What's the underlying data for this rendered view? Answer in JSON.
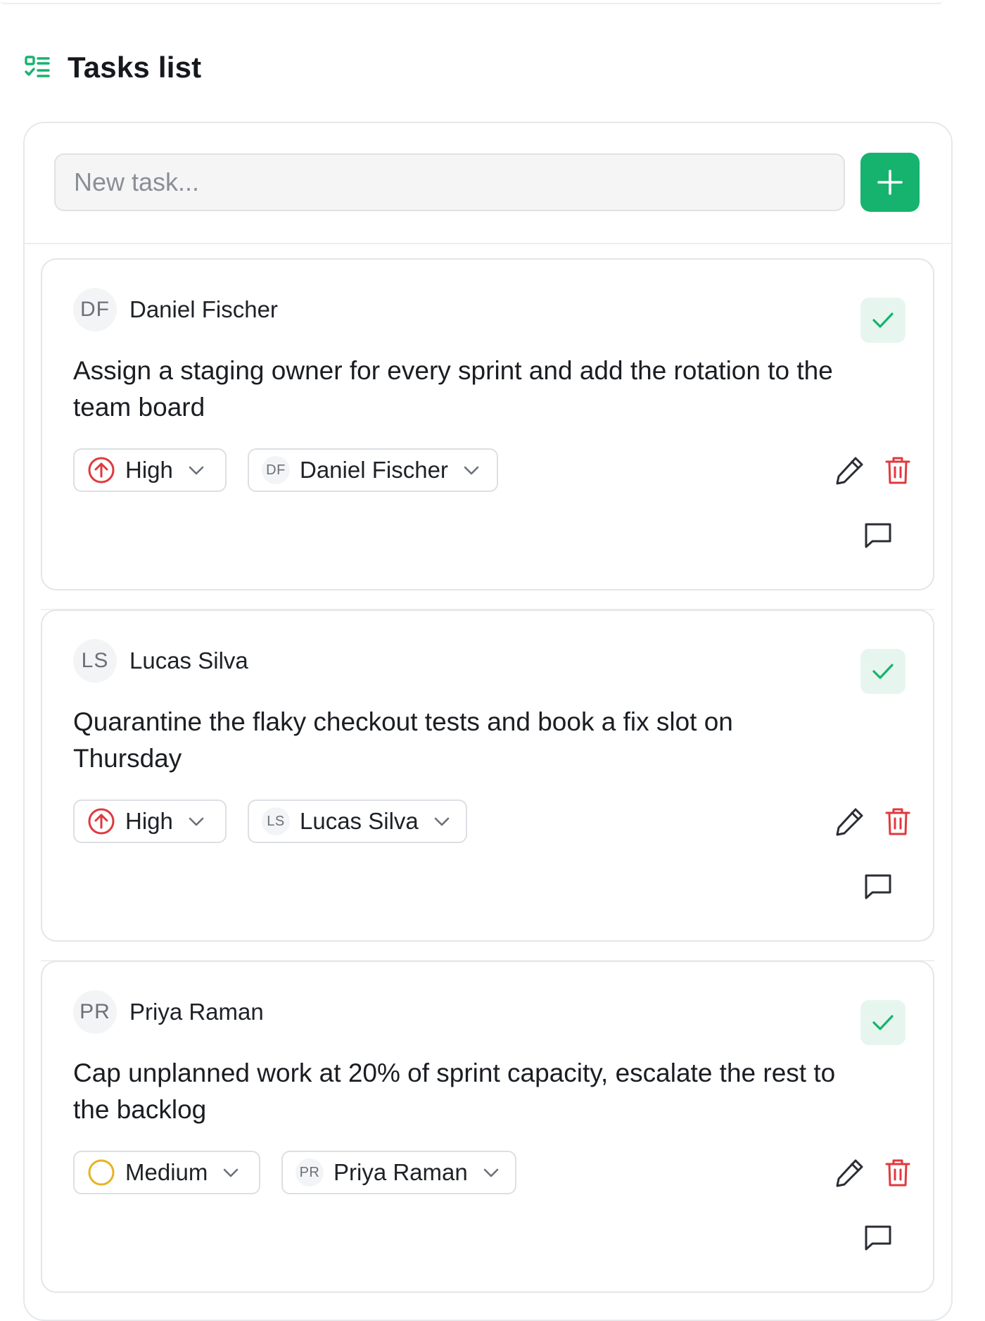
{
  "header": {
    "title": "Tasks list",
    "icon": "task-list-icon"
  },
  "new_task": {
    "placeholder": "New task...",
    "value": ""
  },
  "colors": {
    "accent": "#16b36e",
    "accent_soft": "#e6f6ef",
    "priority_high": "#e0393e",
    "priority_medium": "#e6b422",
    "delete": "#e0393e"
  },
  "tasks": [
    {
      "author_initials": "DF",
      "author_name": "Daniel Fischer",
      "text": "Assign a staging owner for every sprint and add the rotation to the team board",
      "priority": "High",
      "priority_icon": "arrow-up-circle-icon",
      "assignee_initials": "DF",
      "assignee_name": "Daniel Fischer"
    },
    {
      "author_initials": "LS",
      "author_name": "Lucas Silva",
      "text": "Quarantine the flaky checkout tests and book a fix slot on Thursday",
      "priority": "High",
      "priority_icon": "arrow-up-circle-icon",
      "assignee_initials": "LS",
      "assignee_name": "Lucas Silva"
    },
    {
      "author_initials": "PR",
      "author_name": "Priya Raman",
      "text": "Cap unplanned work at 20% of sprint capacity, escalate the rest to the backlog",
      "priority": "Medium",
      "priority_icon": "circle-icon",
      "assignee_initials": "PR",
      "assignee_name": "Priya Raman"
    }
  ]
}
